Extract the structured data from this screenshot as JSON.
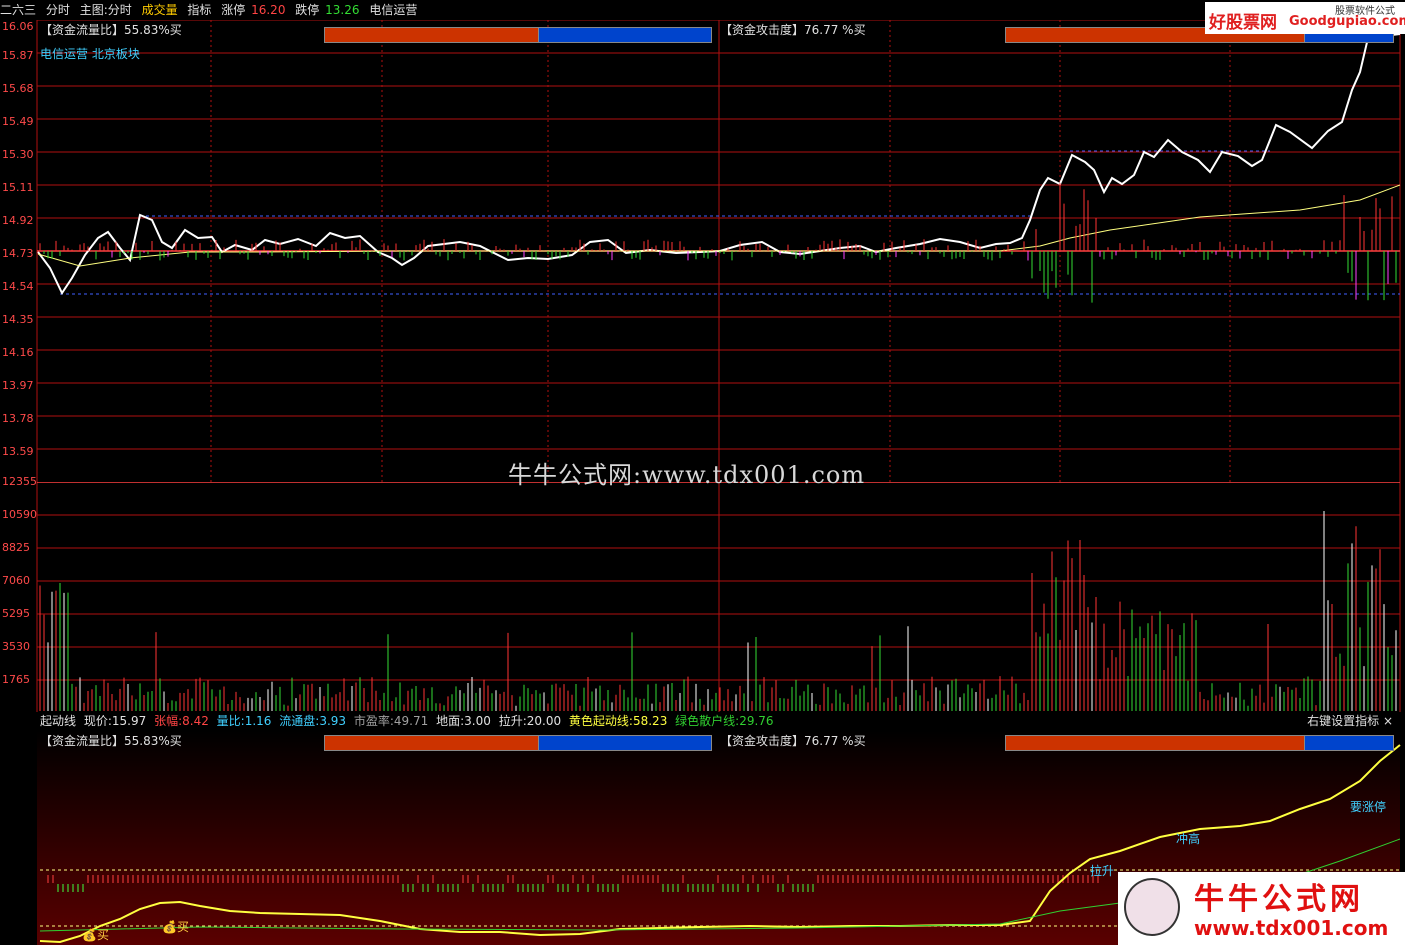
{
  "topbar": {
    "code": "二六三",
    "mode": "分时",
    "main_label": "主图:分时",
    "vol_label": "成交量",
    "indicator": "指标",
    "limit_up_label": "涨停",
    "limit_up": "16.20",
    "limit_down_label": "跌停",
    "limit_down": "13.26",
    "sector": "电信运营"
  },
  "main_panel": {
    "left_title": "【资金流量比】55.83%买",
    "right_title": "【资金攻击度】76.77 %买",
    "sector_tags": "电信运营 北京板块",
    "left_ratio": 0.5583,
    "right_ratio": 0.7677,
    "price_axis": [
      "16.06",
      "15.87",
      "15.68",
      "15.49",
      "15.30",
      "15.11",
      "14.92",
      "14.73",
      "14.54",
      "14.35",
      "14.16",
      "13.97",
      "13.78",
      "13.59"
    ]
  },
  "volume_panel": {
    "axis": [
      "12355",
      "10590",
      "8825",
      "7060",
      "5295",
      "3530",
      "1765"
    ]
  },
  "indicator_bar": {
    "name": "起动线",
    "price_label": "现价:",
    "price": "15.97",
    "change_label": "张幅:",
    "change": "8.42",
    "vr_label": "量比:",
    "vr": "1.16",
    "float_label": "流通盘:",
    "float": "3.93",
    "pe_label": "市盈率:",
    "pe": "49.71",
    "ground_label": "地面:",
    "ground": "3.00",
    "pull_label": "拉升:",
    "pull": "20.00",
    "yellow_label": "黄色起动线:",
    "yellow": "58.23",
    "green_label": "绿色散户线:",
    "green": "29.76",
    "right_hint": "右键设置指标 ×"
  },
  "indicator_panel": {
    "left_title": "【资金流量比】55.83%买",
    "right_title": "【资金攻击度】76.77 %买",
    "annotations": {
      "pull": "拉升",
      "high": "冲高",
      "limit": "要涨停",
      "buy1": "买",
      "buy2": "买"
    }
  },
  "watermark": "牛牛公式网:www.tdx001.com",
  "logo_top": {
    "name": "好股票网",
    "site": "Goodgupiao.com",
    "tag": "股票软件公式"
  },
  "logo_bottom": {
    "name": "牛牛公式网",
    "site": "www.tdx001.com"
  },
  "colors": {
    "up": "#ff3333",
    "down": "#33dd33",
    "grid": "#b01010",
    "price_line": "#ffffff",
    "avg_line": "#ffff80",
    "yellow_line": "#ffff40",
    "green_line": "#30d030"
  }
}
